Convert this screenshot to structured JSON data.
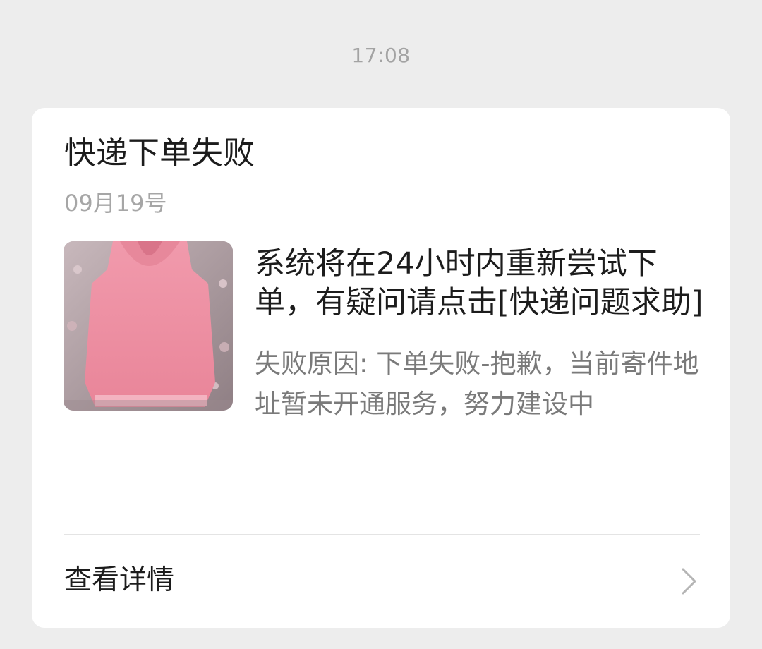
{
  "timestamp": "17:08",
  "card": {
    "title": "快递下单失败",
    "date": "09月19号",
    "thumbnail_icon": "pink-hoodie-photo",
    "message": "系统将在24小时内重新尝试下单，有疑问请点击[快递问题求助]",
    "reason": "失败原因: 下单失败-抱歉，当前寄件地址暂未开通服务，努力建设中",
    "footer_label": "查看详情",
    "footer_icon": "chevron-right-icon"
  }
}
